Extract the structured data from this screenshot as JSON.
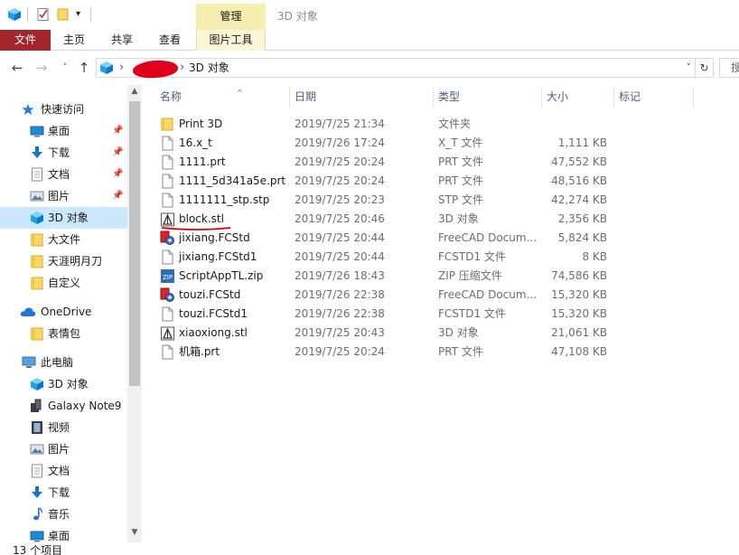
{
  "window": {
    "title": "3D 对象",
    "manage_tab": "管理"
  },
  "ribbon": {
    "tabs": [
      "文件",
      "主页",
      "共享",
      "查看",
      "图片工具"
    ]
  },
  "address": {
    "current": "3D 对象"
  },
  "search": {
    "label": "搜"
  },
  "nav": {
    "quick_access": "快速访问",
    "quick_items": [
      {
        "label": "桌面",
        "icon": "desktop-icon",
        "pinned": true
      },
      {
        "label": "下载",
        "icon": "download-icon",
        "pinned": true
      },
      {
        "label": "文档",
        "icon": "document-icon",
        "pinned": true
      },
      {
        "label": "图片",
        "icon": "picture-icon",
        "pinned": true
      },
      {
        "label": "3D 对象",
        "icon": "3d-objects-icon",
        "pinned": false,
        "selected": true
      },
      {
        "label": "大文件",
        "icon": "folder-icon",
        "pinned": false
      },
      {
        "label": "天涯明月刀",
        "icon": "folder-icon",
        "pinned": false
      },
      {
        "label": "自定义",
        "icon": "folder-icon",
        "pinned": false
      }
    ],
    "onedrive": "OneDrive",
    "onedrive_items": [
      {
        "label": "表情包",
        "icon": "folder-icon"
      }
    ],
    "this_pc": "此电脑",
    "pc_items": [
      {
        "label": "3D 对象",
        "icon": "3d-objects-icon"
      },
      {
        "label": "Galaxy Note9",
        "icon": "phone-icon"
      },
      {
        "label": "视频",
        "icon": "video-icon"
      },
      {
        "label": "图片",
        "icon": "picture-icon"
      },
      {
        "label": "文档",
        "icon": "document-icon"
      },
      {
        "label": "下载",
        "icon": "download-icon"
      },
      {
        "label": "音乐",
        "icon": "music-icon"
      },
      {
        "label": "桌面",
        "icon": "desktop-icon"
      }
    ]
  },
  "columns": {
    "name": "名称",
    "date": "日期",
    "type": "类型",
    "size": "大小",
    "tags": "标记"
  },
  "files": [
    {
      "name": "Print 3D",
      "date": "2019/7/25 21:34",
      "type": "文件夹",
      "size": "",
      "icon": "folder-icon"
    },
    {
      "name": "16.x_t",
      "date": "2019/7/26 17:24",
      "type": "X_T 文件",
      "size": "1,111 KB",
      "icon": "file-icon"
    },
    {
      "name": "1111.prt",
      "date": "2019/7/25 20:24",
      "type": "PRT 文件",
      "size": "47,552 KB",
      "icon": "file-icon"
    },
    {
      "name": "1111_5d341a5e.prt",
      "date": "2019/7/25 20:24",
      "type": "PRT 文件",
      "size": "48,516 KB",
      "icon": "file-icon"
    },
    {
      "name": "1111111_stp.stp",
      "date": "2019/7/25 20:23",
      "type": "STP 文件",
      "size": "42,274 KB",
      "icon": "file-icon"
    },
    {
      "name": "block.stl",
      "date": "2019/7/25 20:46",
      "type": "3D 对象",
      "size": "2,356 KB",
      "icon": "stl-file-icon"
    },
    {
      "name": "jixiang.FCStd",
      "date": "2019/7/25 20:44",
      "type": "FreeCAD Docum...",
      "size": "5,824 KB",
      "icon": "freecad-file-icon"
    },
    {
      "name": "jixiang.FCStd1",
      "date": "2019/7/25 20:44",
      "type": "FCSTD1 文件",
      "size": "8 KB",
      "icon": "file-icon"
    },
    {
      "name": "ScriptAppTL.zip",
      "date": "2019/7/26 18:43",
      "type": "ZIP 压缩文件",
      "size": "74,586 KB",
      "icon": "zip-file-icon"
    },
    {
      "name": "touzi.FCStd",
      "date": "2019/7/26 22:38",
      "type": "FreeCAD Docum...",
      "size": "15,320 KB",
      "icon": "freecad-file-icon"
    },
    {
      "name": "touzi.FCStd1",
      "date": "2019/7/26 22:38",
      "type": "FCSTD1 文件",
      "size": "15,320 KB",
      "icon": "file-icon"
    },
    {
      "name": "xiaoxiong.stl",
      "date": "2019/7/25 20:43",
      "type": "3D 对象",
      "size": "21,061 KB",
      "icon": "stl-file-icon"
    },
    {
      "name": "机箱.prt",
      "date": "2019/7/25 20:24",
      "type": "PRT 文件",
      "size": "47,108 KB",
      "icon": "file-icon"
    }
  ],
  "status": {
    "item_count": "13 个项目"
  },
  "colors": {
    "file_tab": "#a4262c",
    "manage_tab": "#f6eeb0",
    "selection": "#cce8ff",
    "annotation_underline": "#d40000"
  }
}
